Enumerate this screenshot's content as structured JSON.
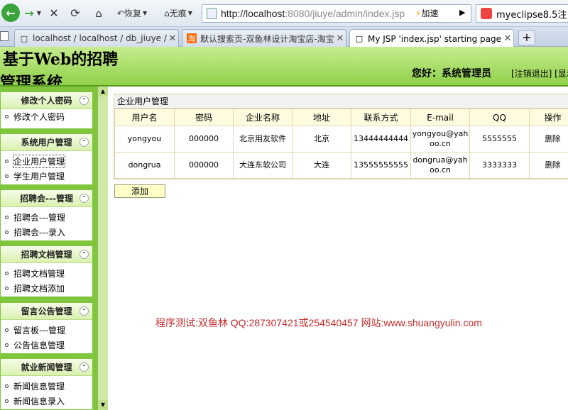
{
  "toolbar": {
    "restore_label": "恢复",
    "no_trace_label": "无痕",
    "url_host": "http://localhost",
    "url_rest": ":8080/jiuye/admin/index.jsp",
    "accelerate_label": "加速",
    "search_text": "myeclipse8.5注"
  },
  "tabs": [
    {
      "label": "localhost / localhost / db_jiuye / t_..."
    },
    {
      "label": "默认搜索页-双鱼林设计淘宝店-淘宝网"
    },
    {
      "label": "My JSP 'index.jsp' starting page"
    }
  ],
  "header": {
    "title_line1": "基于Web的招聘",
    "title_line2": "管理系统",
    "welcome": "您好：系统管理员",
    "links": "[注销退出] [显示"
  },
  "sidebar": {
    "groups": [
      {
        "title": "修改个人密码",
        "items": [
          "修改个人密码"
        ]
      },
      {
        "title": "系统用户管理",
        "items": [
          "企业用户管理",
          "学生用户管理"
        ]
      },
      {
        "title": "招聘会---管理",
        "items": [
          "招聘会---管理",
          "招聘会---录入"
        ]
      },
      {
        "title": "招聘文档管理",
        "items": [
          "招聘文档管理",
          "招聘文档添加"
        ]
      },
      {
        "title": "留言公告管理",
        "items": [
          "留言板---管理",
          "公告信息管理"
        ]
      },
      {
        "title": "就业新闻管理",
        "items": [
          "新闻信息管理",
          "新闻信息录入"
        ]
      }
    ]
  },
  "main": {
    "panel_title": "企业用户管理",
    "columns": [
      "用户名",
      "密码",
      "企业名称",
      "地址",
      "联系方式",
      "E-mail",
      "QQ",
      "操作"
    ],
    "rows": [
      [
        "yongyou",
        "000000",
        "北京用友软件",
        "北京",
        "13444444444",
        "yongyou@yahoo.cn",
        "5555555",
        "删除"
      ],
      [
        "dongrua",
        "000000",
        "大连东软公司",
        "大连",
        "13555555555",
        "dongrua@yahoo.cn",
        "3333333",
        "删除"
      ]
    ],
    "add_label": "添加",
    "footer_note": "程序测试:双鱼林 QQ:287307421或254540457 网站:www.shuangyulin.com"
  }
}
